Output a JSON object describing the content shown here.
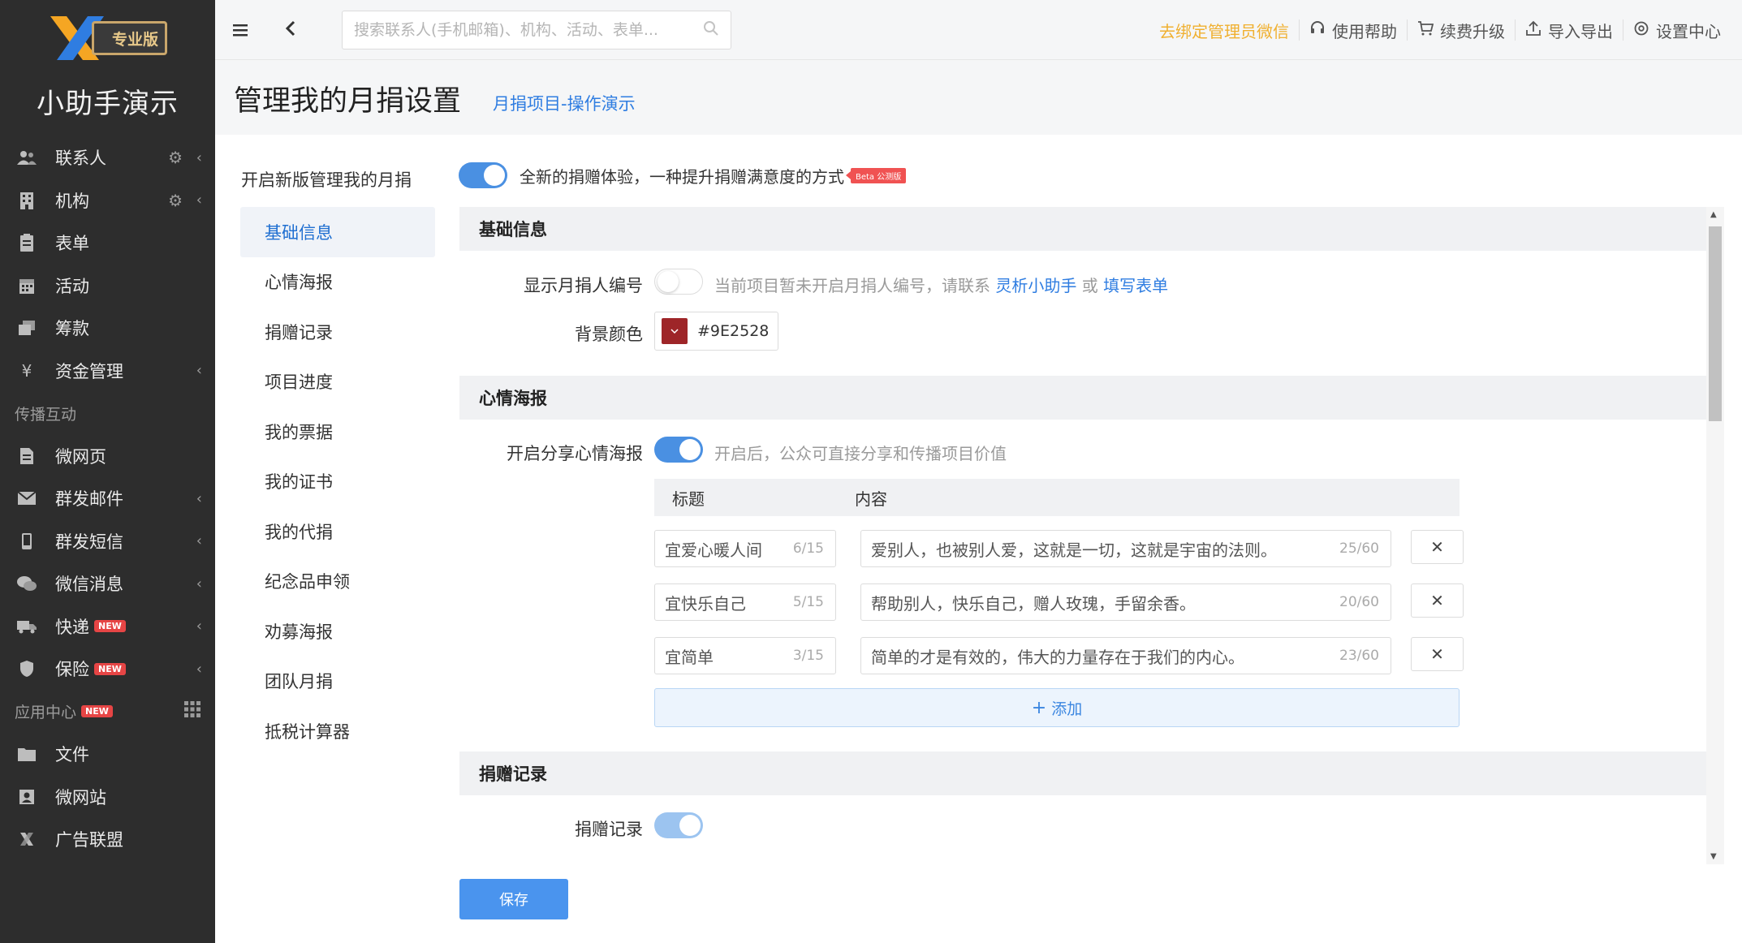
{
  "sidebar": {
    "badge": "专业版",
    "brand": "小助手演示",
    "items": [
      {
        "label": "联系人",
        "icon": "contacts-icon",
        "gear": true,
        "chevron": true
      },
      {
        "label": "机构",
        "icon": "building-icon",
        "gear": true,
        "chevron": true
      },
      {
        "label": "表单",
        "icon": "form-icon",
        "gear": false,
        "chevron": false
      },
      {
        "label": "活动",
        "icon": "calendar-icon",
        "gear": false,
        "chevron": false
      },
      {
        "label": "筹款",
        "icon": "fundraising-icon",
        "gear": false,
        "chevron": false
      },
      {
        "label": "资金管理",
        "icon": "yen-icon",
        "gear": false,
        "chevron": true
      }
    ],
    "section_spread": "传播互动",
    "spread_items": [
      {
        "label": "微网页",
        "icon": "page-icon",
        "chevron": false,
        "new": false
      },
      {
        "label": "群发邮件",
        "icon": "mail-icon",
        "chevron": true,
        "new": false
      },
      {
        "label": "群发短信",
        "icon": "phone-icon",
        "chevron": true,
        "new": false
      },
      {
        "label": "微信消息",
        "icon": "wechat-icon",
        "chevron": true,
        "new": false
      },
      {
        "label": "快递",
        "icon": "truck-icon",
        "chevron": true,
        "new": true
      },
      {
        "label": "保险",
        "icon": "shield-icon",
        "chevron": true,
        "new": true
      }
    ],
    "section_apps": "应用中心",
    "new_label": "NEW",
    "app_items": [
      {
        "label": "文件",
        "icon": "folder-icon"
      },
      {
        "label": "微网站",
        "icon": "site-icon"
      },
      {
        "label": "广告联盟",
        "icon": "ad-union-icon"
      }
    ]
  },
  "topbar": {
    "search_placeholder": "搜索联系人(手机邮箱)、机构、活动、表单...",
    "bind_wechat": "去绑定管理员微信",
    "help": "使用帮助",
    "upgrade": "续费升级",
    "import_export": "导入导出",
    "settings": "设置中心"
  },
  "header": {
    "title": "管理我的月捐设置",
    "subtitle": "月捐项目-操作演示"
  },
  "left_menu": {
    "title": "开启新版管理我的月捐",
    "items": [
      "基础信息",
      "心情海报",
      "捐赠记录",
      "项目进度",
      "我的票据",
      "我的证书",
      "我的代捐",
      "纪念品申领",
      "劝募海报",
      "团队月捐",
      "抵税计算器"
    ],
    "active_index": 0
  },
  "main": {
    "headline": "全新的捐赠体验，一种提升捐赠满意度的方式",
    "beta": "Beta 公测版",
    "basic": {
      "section": "基础信息",
      "show_id_label": "显示月捐人编号",
      "show_id_hint_prefix": "当前项目暂未开启月捐人编号，请联系",
      "show_id_link1": "灵析小助手",
      "show_id_or": "或",
      "show_id_link2": "填写表单",
      "bg_label": "背景颜色",
      "bg_value": "#9E2528"
    },
    "poster": {
      "section": "心情海报",
      "share_label": "开启分享心情海报",
      "share_hint": "开启后，公众可直接分享和传播项目价值",
      "col_title": "标题",
      "col_content": "内容",
      "rows": [
        {
          "title": "宜爱心暖人间",
          "title_count": "6/15",
          "content": "爱别人，也被别人爱，这就是一切，这就是宇宙的法则。",
          "content_count": "25/60"
        },
        {
          "title": "宜快乐自己",
          "title_count": "5/15",
          "content": "帮助别人，快乐自己，赠人玫瑰，手留余香。",
          "content_count": "20/60"
        },
        {
          "title": "宜简单",
          "title_count": "3/15",
          "content": "简单的才是有效的，伟大的力量存在于我们的内心。",
          "content_count": "23/60"
        }
      ],
      "add_label": "添加"
    },
    "records": {
      "section": "捐赠记录",
      "toggle_label": "捐赠记录"
    },
    "save_label": "保存"
  },
  "colors": {
    "sidebar_bg": "#2d2d2d",
    "accent": "#4a90e2",
    "link": "#2f7de1",
    "warning": "#f0b030",
    "swatch": "#9E2528"
  }
}
